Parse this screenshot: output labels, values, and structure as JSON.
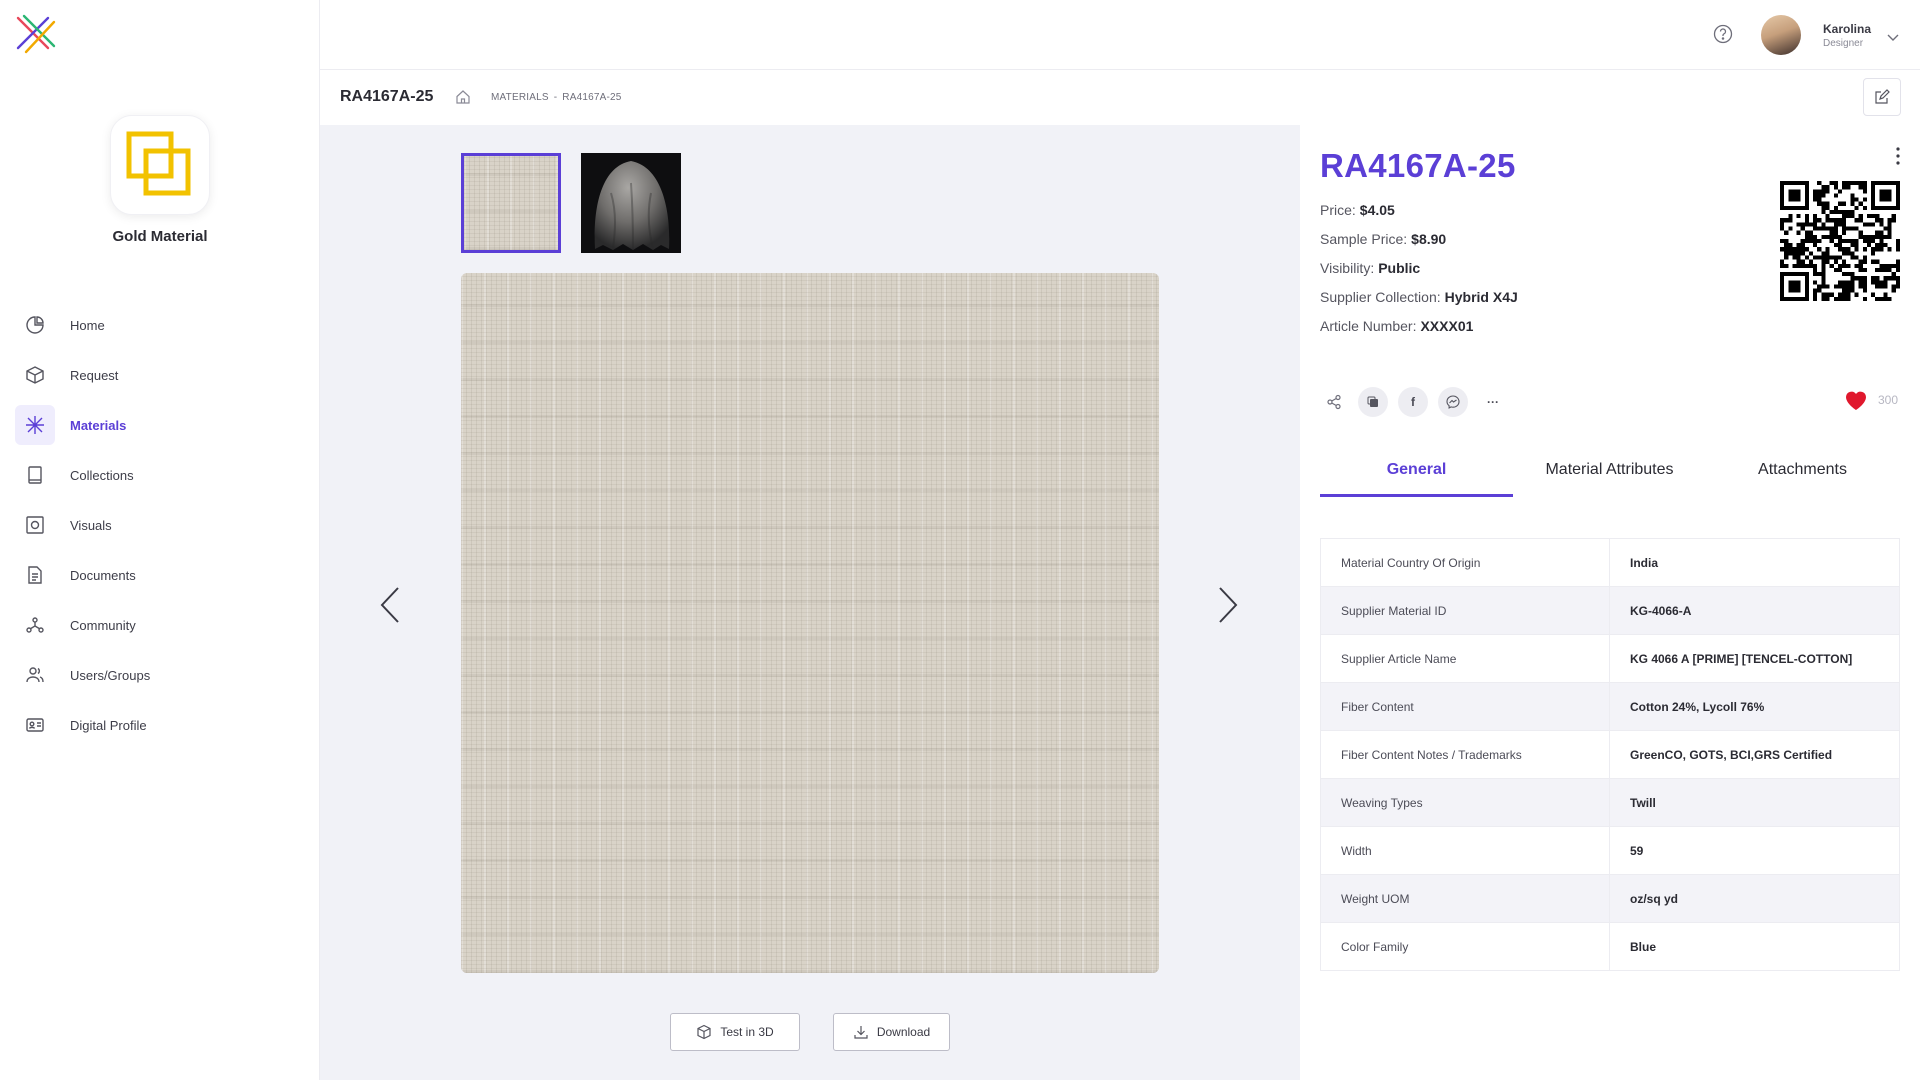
{
  "brand": {
    "name": "Gold Material",
    "logo_color": "#f2c200"
  },
  "sidebar": {
    "active": "Materials",
    "items": [
      {
        "label": "Home",
        "icon": "pie-chart-icon"
      },
      {
        "label": "Request",
        "icon": "cube-icon"
      },
      {
        "label": "Materials",
        "icon": "materials-icon"
      },
      {
        "label": "Collections",
        "icon": "book-icon"
      },
      {
        "label": "Visuals",
        "icon": "camera-frame-icon"
      },
      {
        "label": "Documents",
        "icon": "document-icon"
      },
      {
        "label": "Community",
        "icon": "network-icon"
      },
      {
        "label": "Users/Groups",
        "icon": "users-icon"
      },
      {
        "label": "Digital Profile",
        "icon": "id-card-icon"
      }
    ]
  },
  "user": {
    "name": "Karolina",
    "role": "Designer"
  },
  "page": {
    "title": "RA4167A-25",
    "breadcrumb": [
      "MATERIALS",
      "RA4167A-25"
    ],
    "breadcrumb_sep": "-"
  },
  "gallery": {
    "buttons": {
      "test3d": "Test in 3D",
      "download": "Download"
    }
  },
  "material": {
    "title": "RA4167A-25",
    "fields": [
      {
        "label": "Price:",
        "value": "$4.05"
      },
      {
        "label": "Sample Price:",
        "value": "$8.90"
      },
      {
        "label": "Visibility:",
        "value": "Public"
      },
      {
        "label": "Supplier Collection:",
        "value": "Hybrid X4J"
      },
      {
        "label": "Article Number:",
        "value": "XXXX01"
      }
    ],
    "likes": "300",
    "share": {
      "facebook": "f",
      "more": "···"
    }
  },
  "tabs": [
    {
      "label": "General",
      "active": true
    },
    {
      "label": "Material Attributes",
      "active": false
    },
    {
      "label": "Attachments",
      "active": false
    }
  ],
  "attributes": [
    {
      "key": "Material Country Of Origin",
      "value": "India"
    },
    {
      "key": "Supplier Material ID",
      "value": "KG-4066-A"
    },
    {
      "key": "Supplier Article Name",
      "value": "KG 4066 A [PRIME] [TENCEL-COTTON]"
    },
    {
      "key": "Fiber Content",
      "value": "Cotton 24%, Lycoll 76%"
    },
    {
      "key": "Fiber Content Notes / Trademarks",
      "value": "GreenCO, GOTS, BCI,GRS Certified"
    },
    {
      "key": "Weaving Types",
      "value": "Twill"
    },
    {
      "key": "Width",
      "value": "59"
    },
    {
      "key": "Weight UOM",
      "value": "oz/sq yd"
    },
    {
      "key": "Color Family",
      "value": "Blue"
    }
  ],
  "colors": {
    "accent": "#5b3fd6",
    "heart": "#e0182d"
  }
}
